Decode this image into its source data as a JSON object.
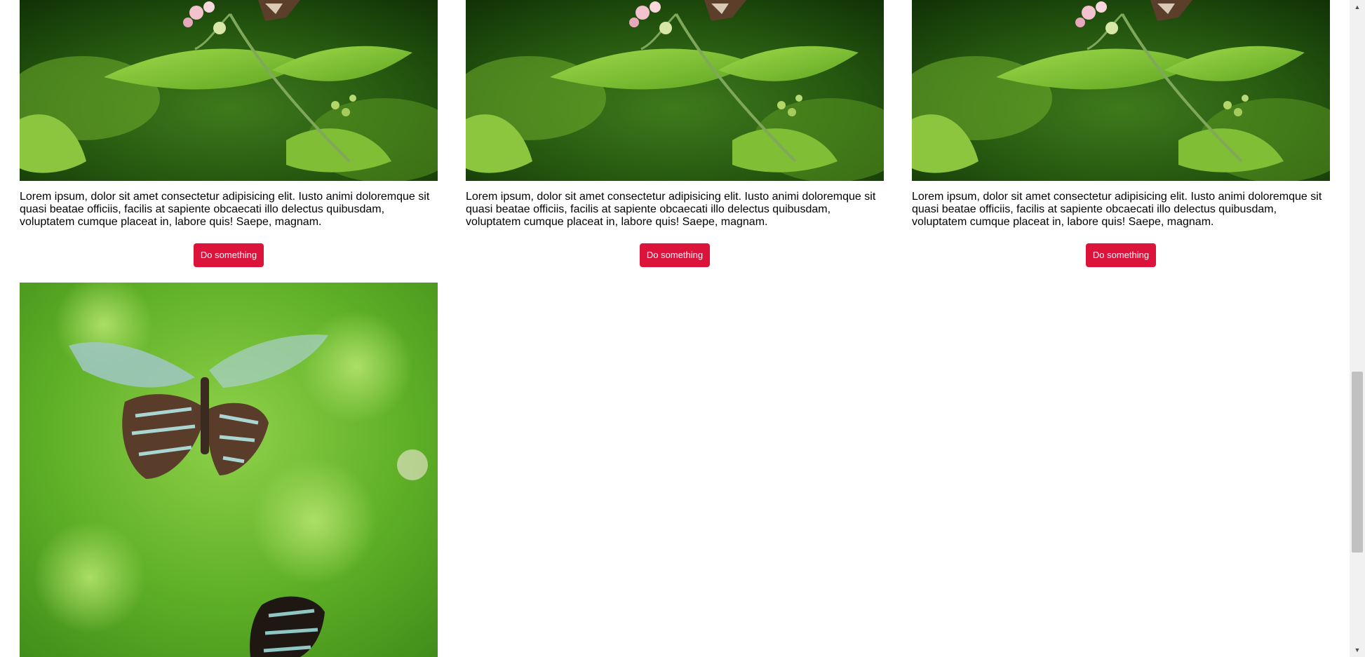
{
  "cards": [
    {
      "text": "Lorem ipsum, dolor sit amet consectetur adipisicing elit. Iusto animi doloremque sit quasi beatae officiis, facilis at sapiente obcaecati illo delectus quibusdam, voluptatem cumque placeat in, labore quis! Saepe, magnam.",
      "button_label": "Do something",
      "image": "butterfly-on-flowers-photo"
    },
    {
      "text": "Lorem ipsum, dolor sit amet consectetur adipisicing elit. Iusto animi doloremque sit quasi beatae officiis, facilis at sapiente obcaecati illo delectus quibusdam, voluptatem cumque placeat in, labore quis! Saepe, magnam.",
      "button_label": "Do something",
      "image": "butterfly-on-flowers-photo"
    },
    {
      "text": "Lorem ipsum, dolor sit amet consectetur adipisicing elit. Iusto animi doloremque sit quasi beatae officiis, facilis at sapiente obcaecati illo delectus quibusdam, voluptatem cumque placeat in, labore quis! Saepe, magnam.",
      "button_label": "Do something",
      "image": "butterfly-on-flowers-photo"
    },
    {
      "image": "flying-butterfly-photo"
    }
  ],
  "colors": {
    "button": "#dc143c",
    "button_text": "#ffffff"
  },
  "scrollbar": {
    "up_icon": "arrow-up-icon",
    "down_icon": "arrow-down-icon"
  }
}
